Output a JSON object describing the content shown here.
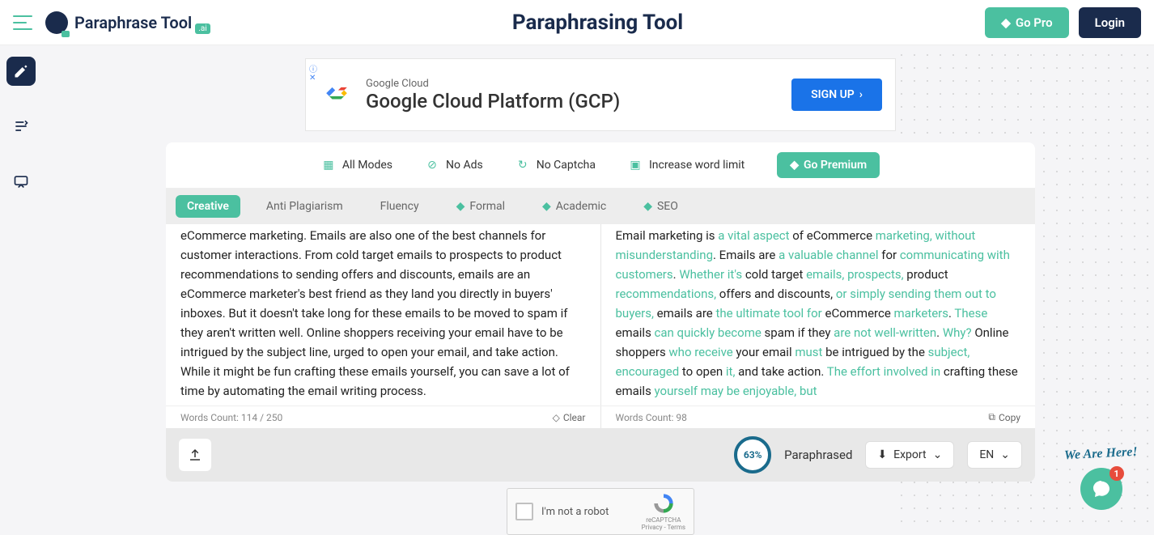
{
  "header": {
    "logo_text": "Paraphrase Tool",
    "logo_badge": ".ai",
    "page_title": "Paraphrasing Tool",
    "go_pro": "Go Pro",
    "login": "Login"
  },
  "ad": {
    "subtitle": "Google Cloud",
    "title": "Google Cloud Platform (GCP)",
    "cta": "SIGN UP"
  },
  "premium_features": {
    "all_modes": "All Modes",
    "no_ads": "No Ads",
    "no_captcha": "No Captcha",
    "word_limit": "Increase word limit",
    "cta": "Go Premium"
  },
  "modes": {
    "creative": "Creative",
    "anti_plagiarism": "Anti Plagiarism",
    "fluency": "Fluency",
    "formal": "Formal",
    "academic": "Academic",
    "seo": "SEO"
  },
  "input": {
    "text": "eCommerce marketing. Emails are also one of the best channels for customer interactions. From cold target emails to prospects to product recommendations to sending offers and discounts, emails are an eCommerce marketer's best friend as they land you directly in buyers' inboxes. But it doesn't take long for these emails to be moved to spam if they aren't written well. Online shoppers receiving your email have to be intrigued by the subject line, urged to open your email, and take action. While it might be fun crafting these emails yourself, you can save a lot of time by automating the email writing process.",
    "words_label": "Words Count: ",
    "words_value": "114 / 250",
    "clear": "Clear"
  },
  "output": {
    "segments": [
      {
        "t": "Email marketing is ",
        "h": false
      },
      {
        "t": "a vital aspect",
        "h": true
      },
      {
        "t": " of eCommerce ",
        "h": false
      },
      {
        "t": "marketing, without misunderstanding",
        "h": true
      },
      {
        "t": ". Emails are ",
        "h": false
      },
      {
        "t": "a valuable channel",
        "h": true
      },
      {
        "t": " for ",
        "h": false
      },
      {
        "t": "communicating with customers",
        "h": true
      },
      {
        "t": ". ",
        "h": false
      },
      {
        "t": "Whether it's",
        "h": true
      },
      {
        "t": " cold target ",
        "h": false
      },
      {
        "t": "emails, prospects,",
        "h": true
      },
      {
        "t": " product ",
        "h": false
      },
      {
        "t": "recommendations,",
        "h": true
      },
      {
        "t": " offers and discounts, ",
        "h": false
      },
      {
        "t": "or simply sending them out to buyers,",
        "h": true
      },
      {
        "t": " emails are ",
        "h": false
      },
      {
        "t": "the ultimate tool for",
        "h": true
      },
      {
        "t": " eCommerce ",
        "h": false
      },
      {
        "t": "marketers",
        "h": true
      },
      {
        "t": ". ",
        "h": false
      },
      {
        "t": "These",
        "h": true
      },
      {
        "t": " emails ",
        "h": false
      },
      {
        "t": "can quickly become",
        "h": true
      },
      {
        "t": " spam if they ",
        "h": false
      },
      {
        "t": "are not well-written",
        "h": true
      },
      {
        "t": ". ",
        "h": false
      },
      {
        "t": "Why?",
        "h": true
      },
      {
        "t": " Online shoppers ",
        "h": false
      },
      {
        "t": "who receive",
        "h": true
      },
      {
        "t": " your email ",
        "h": false
      },
      {
        "t": "must",
        "h": true
      },
      {
        "t": " be intrigued by the ",
        "h": false
      },
      {
        "t": "subject, encouraged",
        "h": true
      },
      {
        "t": " to open ",
        "h": false
      },
      {
        "t": "it,",
        "h": true
      },
      {
        "t": " and take action. ",
        "h": false
      },
      {
        "t": "The effort involved in",
        "h": true
      },
      {
        "t": " crafting these emails ",
        "h": false
      },
      {
        "t": "yourself may be enjoyable, but",
        "h": true
      }
    ],
    "words_label": "Words Count: ",
    "words_value": "98",
    "copy": "Copy"
  },
  "bottom": {
    "percent": "63%",
    "paraphrased": "Paraphrased",
    "export": "Export",
    "lang": "EN"
  },
  "recaptcha": {
    "text": "I'm not a robot",
    "brand": "reCAPTCHA",
    "privacy": "Privacy - Terms"
  },
  "float": {
    "we_are_here": "We Are Here!",
    "badge": "1"
  }
}
